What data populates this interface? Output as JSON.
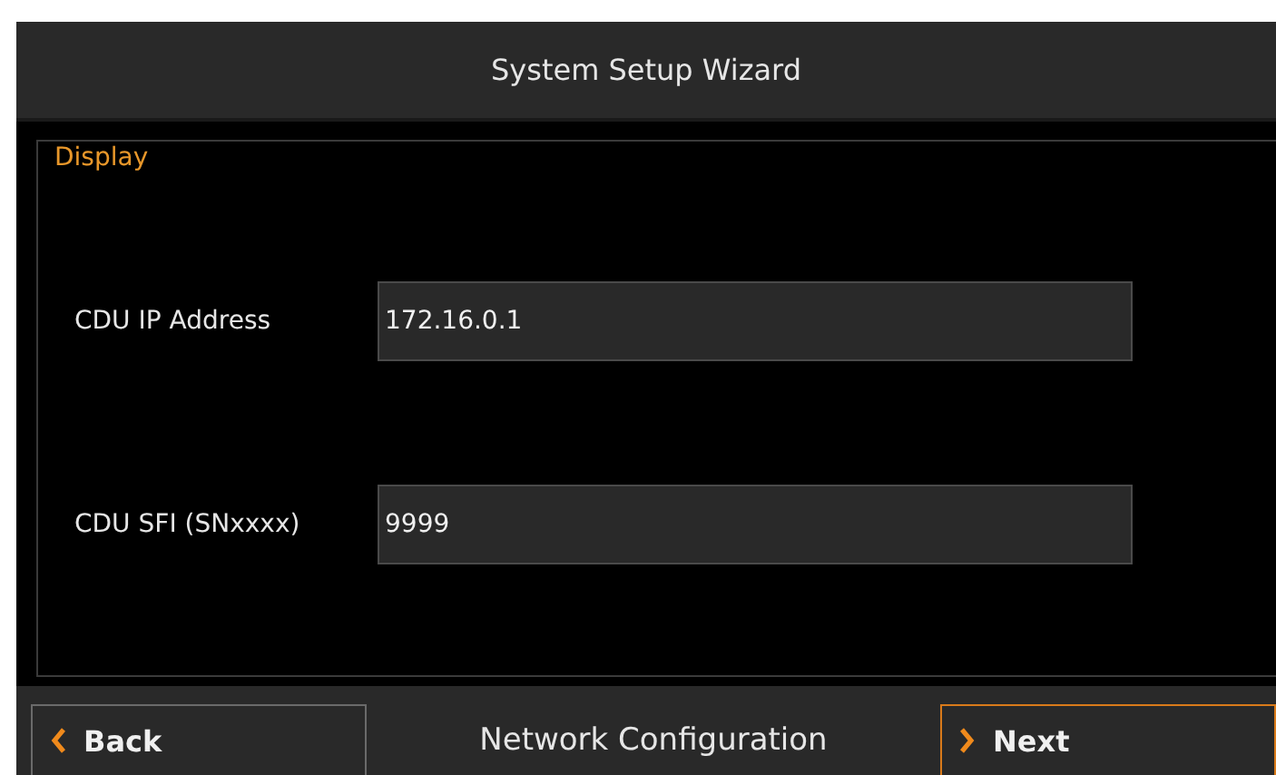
{
  "window": {
    "title": "System Setup Wizard"
  },
  "panel": {
    "title": "Display",
    "fields": [
      {
        "label": "CDU IP Address",
        "value": "172.16.0.1"
      },
      {
        "label": "CDU SFI (SNxxxx)",
        "value": "9999"
      }
    ]
  },
  "footer": {
    "back": {
      "label": "Back",
      "highlighted": false
    },
    "step": "Network Configuration",
    "next": {
      "label": "Next",
      "highlighted": true
    }
  }
}
